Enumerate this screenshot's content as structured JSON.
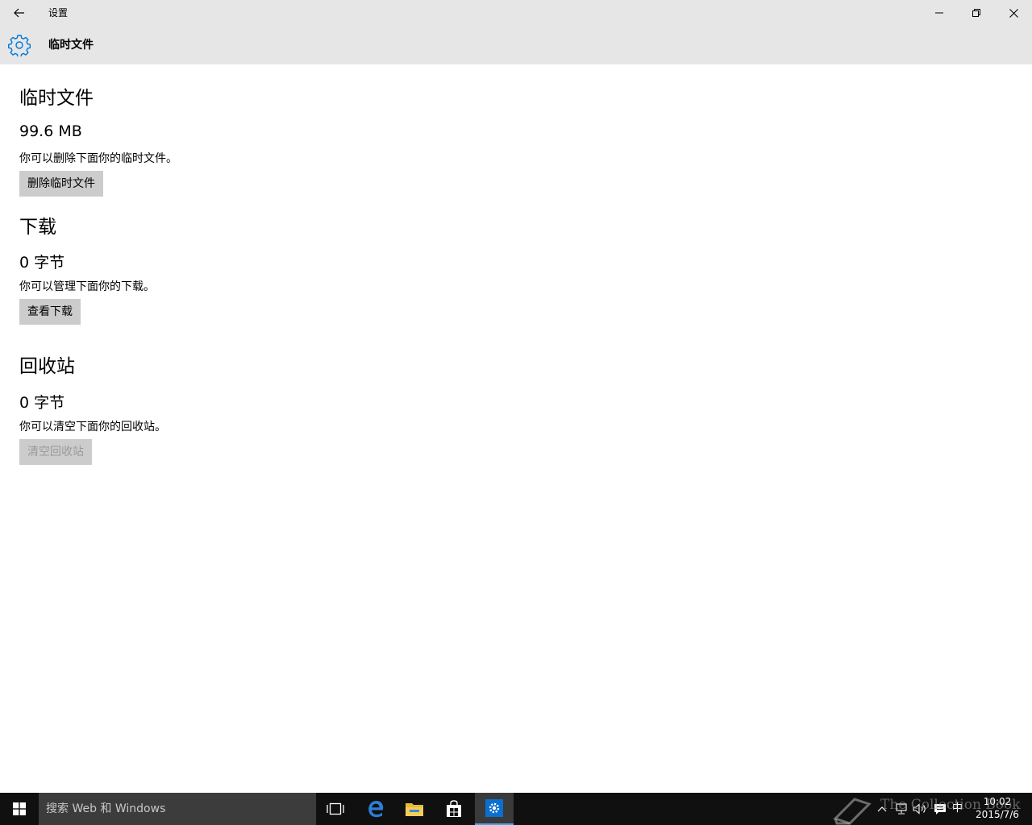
{
  "window": {
    "title": "设置",
    "controls": {
      "minimize": "minimize-icon",
      "restore": "restore-icon",
      "close": "close-icon"
    }
  },
  "header": {
    "icon": "gear-icon",
    "title": "临时文件"
  },
  "sections": [
    {
      "title": "临时文件",
      "size": "99.6 MB",
      "description": "你可以删除下面你的临时文件。",
      "button": "删除临时文件",
      "button_enabled": true
    },
    {
      "title": "下载",
      "size": "0 字节",
      "description": "你可以管理下面你的下载。",
      "button": "查看下载",
      "button_enabled": true
    },
    {
      "title": "回收站",
      "size": "0 字节",
      "description": "你可以清空下面你的回收站。",
      "button": "清空回收站",
      "button_enabled": false
    }
  ],
  "taskbar": {
    "search_placeholder": "搜索 Web 和 Windows",
    "apps": [
      "task-view-icon",
      "edge-icon",
      "file-explorer-icon",
      "store-icon",
      "settings-icon"
    ],
    "active_app": "settings-icon",
    "tray": [
      "chevron-up-icon",
      "network-icon",
      "volume-icon",
      "action-center-icon"
    ],
    "ime": "中",
    "time": "10:02",
    "date": "2015/7/6"
  },
  "watermark": {
    "text": "The Collection Book"
  },
  "colors": {
    "titlebar_bg": "#e6e6e6",
    "accent": "#0078d7",
    "button_bg": "#cccccc",
    "taskbar_bg": "#101010",
    "search_bg": "#3c3c3c"
  }
}
